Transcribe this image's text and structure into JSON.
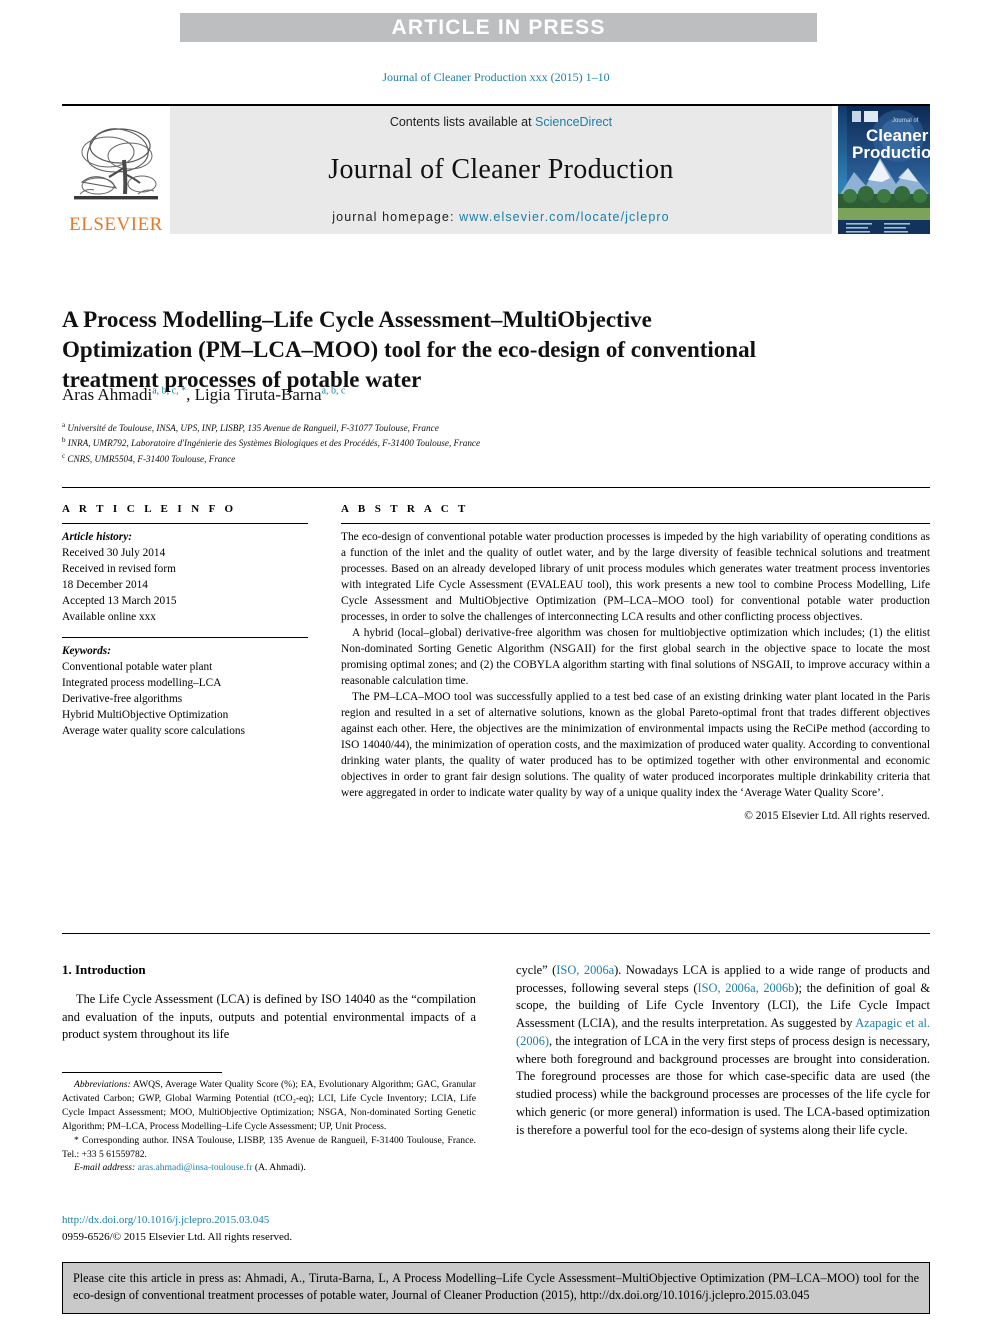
{
  "banner": {
    "text": "ARTICLE IN PRESS"
  },
  "running_head": "Journal of Cleaner Production xxx (2015) 1–10",
  "masthead": {
    "contents_prefix": "Contents lists available at ",
    "sciencedirect": "ScienceDirect",
    "journal_name": "Journal of Cleaner Production",
    "homepage_label": "journal homepage: ",
    "homepage_url": "www.elsevier.com/locate/jclepro",
    "publisher": "ELSEVIER",
    "cover_title_small": "Journal of",
    "cover_title_line1": "Cleaner",
    "cover_title_line2": "Production",
    "accent_link_color": "#1b7fa8",
    "elsevier_orange": "#E87722",
    "banner_gray": "#bcbec0"
  },
  "article": {
    "title": "A Process Modelling–Life Cycle Assessment–MultiObjective Optimization (PM–LCA–MOO) tool for the eco-design of conventional treatment processes of potable water",
    "authors_1": "Aras Ahmadi",
    "authors_1_sup": "a, b, c, *",
    "authors_2": "Ligia Tiruta-Barna",
    "authors_2_sup": "a, b, c",
    "affiliations": [
      {
        "marker": "a",
        "text": "Université de Toulouse, INSA, UPS, INP, LISBP, 135 Avenue de Rangueil, F-31077 Toulouse, France"
      },
      {
        "marker": "b",
        "text": "INRA, UMR792, Laboratoire d'Ingénierie des Systèmes Biologiques et des Procédés, F-31400 Toulouse, France"
      },
      {
        "marker": "c",
        "text": "CNRS, UMR5504, F-31400 Toulouse, France"
      }
    ]
  },
  "article_info": {
    "heading": "A R T I C L E    I N F O",
    "history_label": "Article history:",
    "history": [
      "Received 30 July 2014",
      "Received in revised form",
      "18 December 2014",
      "Accepted 13 March 2015",
      "Available online xxx"
    ],
    "keywords_label": "Keywords:",
    "keywords": [
      "Conventional potable water plant",
      "Integrated process modelling–LCA",
      "Derivative-free algorithms",
      "Hybrid MultiObjective Optimization",
      "Average water quality score calculations"
    ]
  },
  "abstract": {
    "heading": "A B S T R A C T",
    "paragraphs": [
      "The eco-design of conventional potable water production processes is impeded by the high variability of operating conditions as a function of the inlet and the quality of outlet water, and by the large diversity of feasible technical solutions and treatment processes. Based on an already developed library of unit process modules which generates water treatment process inventories with integrated Life Cycle Assessment (EVALEAU tool), this work presents a new tool to combine Process Modelling, Life Cycle Assessment and MultiObjective Optimization (PM–LCA–MOO tool) for conventional potable water production processes, in order to solve the challenges of interconnecting LCA results and other conflicting process objectives.",
      "A hybrid (local–global) derivative-free algorithm was chosen for multiobjective optimization which includes; (1) the elitist Non-dominated Sorting Genetic Algorithm (NSGAII) for the first global search in the objective space to locate the most promising optimal zones; and (2) the COBYLA algorithm starting with final solutions of NSGAII, to improve accuracy within a reasonable calculation time.",
      "The PM–LCA–MOO tool was successfully applied to a test bed case of an existing drinking water plant located in the Paris region and resulted in a set of alternative solutions, known as the global Pareto-optimal front that trades different objectives against each other. Here, the objectives are the minimization of environmental impacts using the ReCiPe method (according to ISO 14040/44), the minimization of operation costs, and the maximization of produced water quality. According to conventional drinking water plants, the quality of water produced has to be optimized together with other environmental and economic objectives in order to grant fair design solutions. The quality of water produced incorporates multiple drinkability criteria that were aggregated in order to indicate water quality by way of a unique quality index the ‘Average Water Quality Score’."
    ],
    "copyright": "© 2015 Elsevier Ltd. All rights reserved."
  },
  "introduction": {
    "heading": "1. Introduction",
    "left_text_pre": "The Life Cycle Assessment (LCA) is defined by ISO 14040 as the “compilation and evaluation of the inputs, outputs and potential environmental impacts of a product system throughout its life",
    "right_part1": "cycle” (",
    "right_link1": "ISO, 2006a",
    "right_part2": "). Nowadays LCA is applied to a wide range of products and processes, following several steps (",
    "right_link2": "ISO, 2006a, 2006b",
    "right_part3": "); the definition of goal & scope, the building of Life Cycle Inventory (LCI), the Life Cycle Impact Assessment (LCIA), and the results interpretation. As suggested by ",
    "right_link3": "Azapagic et al. (2006)",
    "right_part4": ", the integration of LCA in the very first steps of process design is necessary, where both foreground and background processes are brought into consideration. The foreground processes are those for which case-specific data are used (the studied process) while the background processes are processes of the life cycle for which generic (or more general) information is used. The LCA-based optimization is therefore a powerful tool for the eco-design of systems along their life cycle."
  },
  "footnotes": {
    "abbrev_label": "Abbreviations:",
    "abbrev_text": " AWQS, Average Water Quality Score (%); EA, Evolutionary Algorithm; GAC, Granular Activated Carbon; GWP, Global Warming Potential (tCO₂-eq); LCI, Life Cycle Inventory; LCIA, Life Cycle Impact Assessment; MOO, MultiObjective Optimization; NSGA, Non-dominated Sorting Genetic Algorithm; PM–LCA, Process Modelling–Life Cycle Assessment; UP, Unit Process.",
    "corresponding": "* Corresponding author. INSA Toulouse, LISBP, 135 Avenue de Rangueil, F-31400 Toulouse, France. Tel.: +33 5 61559782.",
    "email_label": "E-mail address:",
    "email": "aras.ahmadi@insa-toulouse.fr",
    "email_suffix": " (A. Ahmadi)."
  },
  "doi_footer": {
    "doi_link": "http://dx.doi.org/10.1016/j.jclepro.2015.03.045",
    "issn_line": "0959-6526/© 2015 Elsevier Ltd. All rights reserved."
  },
  "citation_box": {
    "text": "Please cite this article in press as: Ahmadi, A., Tiruta-Barna, L, A Process Modelling–Life Cycle Assessment–MultiObjective Optimization (PM–LCA–MOO) tool for the eco-design of conventional treatment processes of potable water, Journal of Cleaner Production (2015), http://dx.doi.org/10.1016/j.jclepro.2015.03.045"
  }
}
